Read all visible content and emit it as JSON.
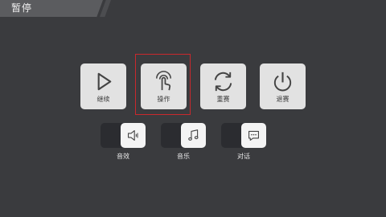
{
  "header": {
    "title": "暂停"
  },
  "main_buttons": [
    {
      "label": "继续",
      "icon": "play-icon"
    },
    {
      "label": "操作",
      "icon": "tap-hand-icon"
    },
    {
      "label": "重赛",
      "icon": "restart-icon"
    },
    {
      "label": "退赛",
      "icon": "power-icon"
    }
  ],
  "toggles": [
    {
      "label": "音效",
      "icon": "speaker-icon"
    },
    {
      "label": "音乐",
      "icon": "music-note-icon"
    },
    {
      "label": "对话",
      "icon": "chat-bubble-icon"
    }
  ],
  "colors": {
    "background": "#3a3b3e",
    "button_bg": "#e2e2e2",
    "selection_border": "#c9282d",
    "toggle_track": "#2b2c30",
    "toggle_knob": "#f4f4f4"
  }
}
